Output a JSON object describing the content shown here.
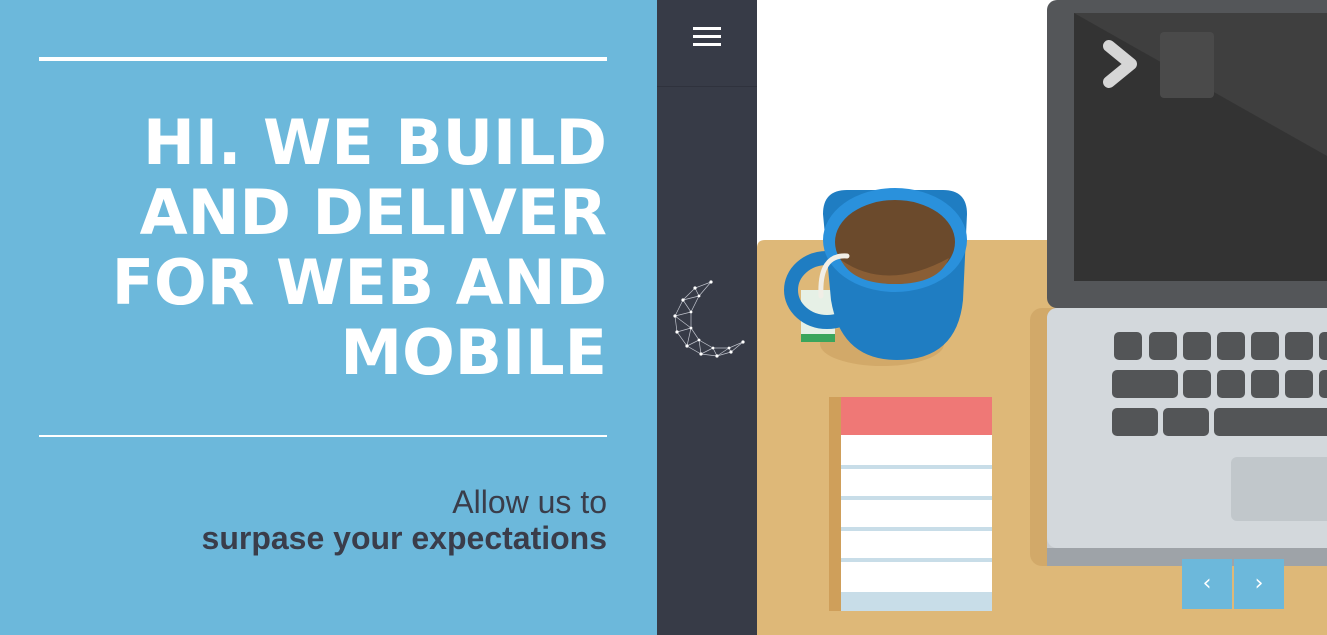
{
  "hero": {
    "headline_lines": [
      "HI. WE BUILD",
      "AND DELIVER",
      "FOR WEB AND",
      "MOBILE"
    ],
    "tagline_light": "Allow us to",
    "tagline_bold": "surpase your expectations"
  },
  "sidebar": {
    "menu_icon": "hamburger-icon",
    "logo_icon": "crescent-moon-constellation-icon"
  },
  "slider": {
    "prev_label": "‹",
    "next_label": "›",
    "prev_icon": "chevron-left-icon",
    "next_icon": "chevron-right-icon"
  },
  "colors": {
    "accent": "#6cb8db",
    "sidebar": "#373b47",
    "desk": "#deb878",
    "text_dark": "#3a3d4a"
  }
}
